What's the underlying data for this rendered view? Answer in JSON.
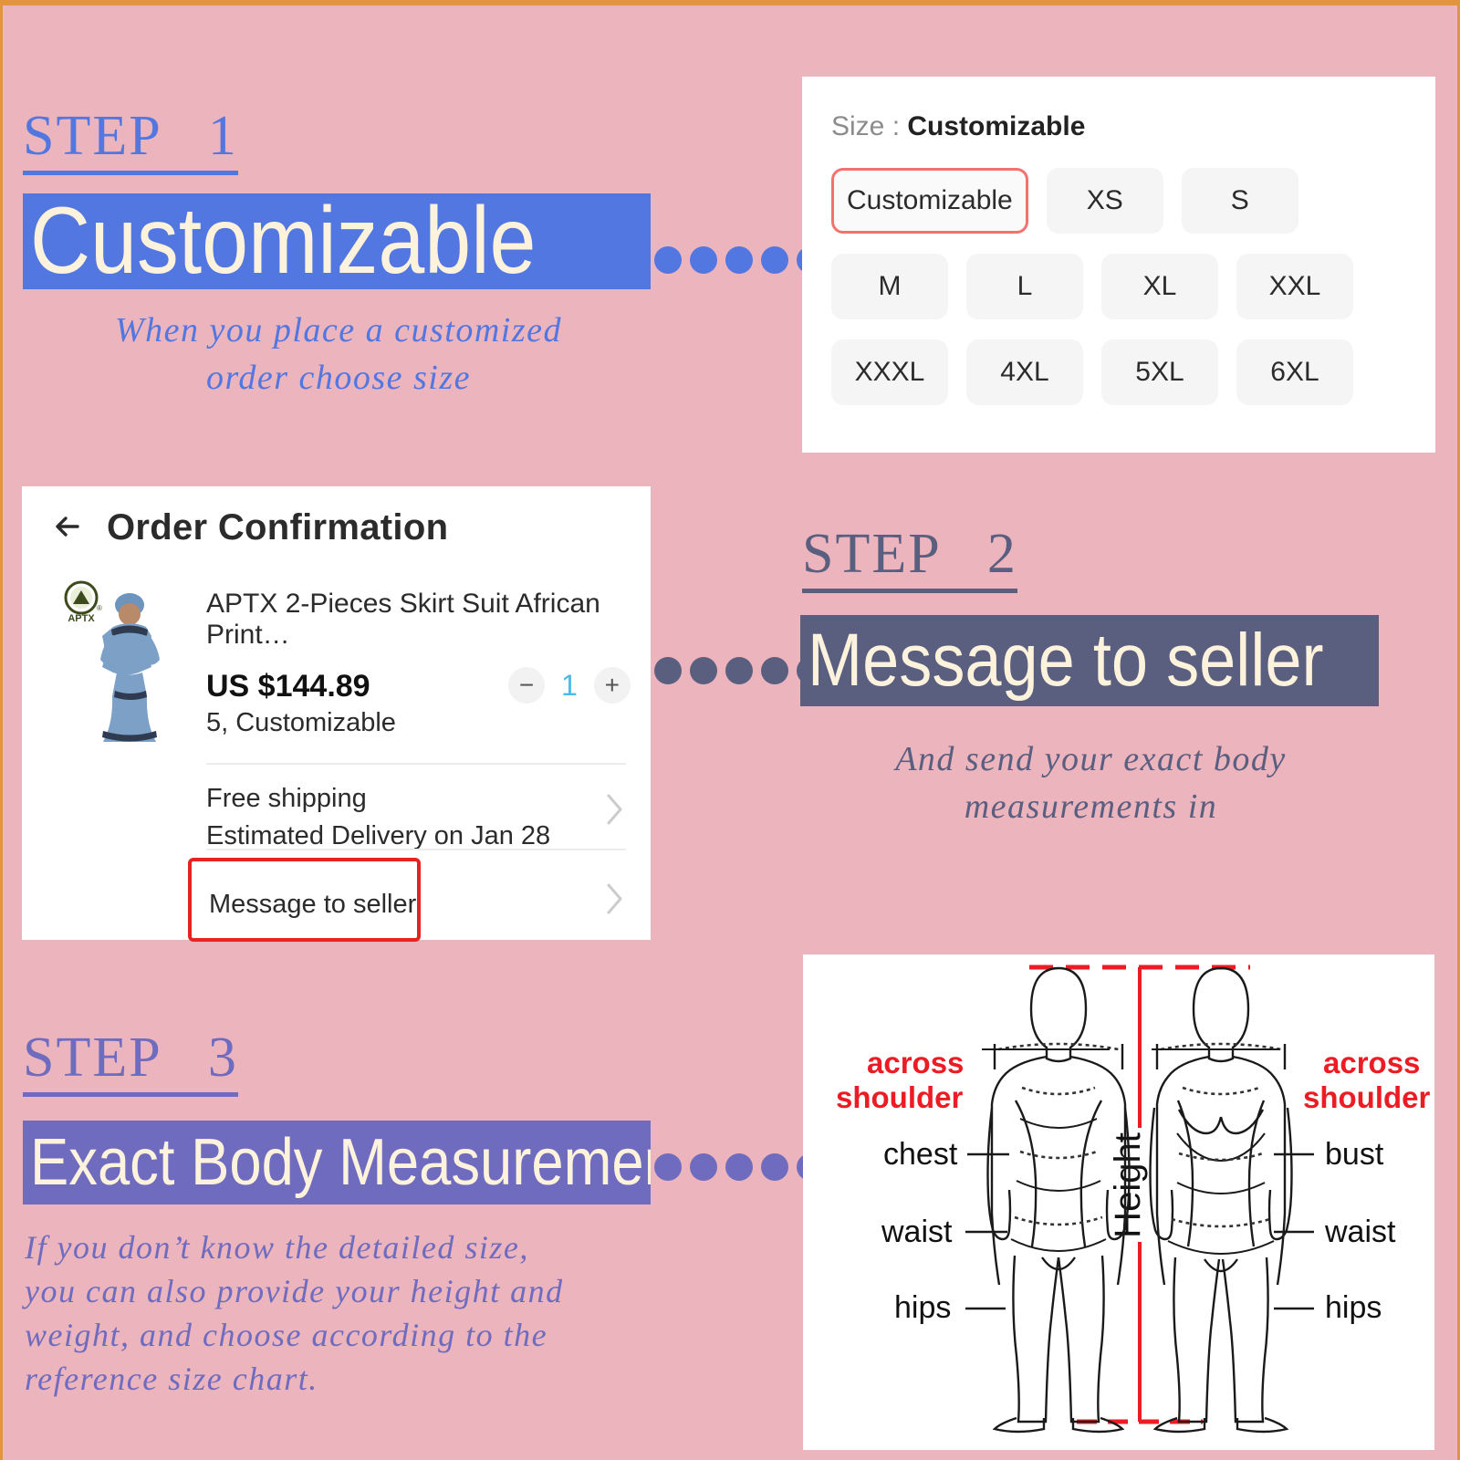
{
  "page": {
    "background_color": "#ecb4bc",
    "border_color": "#e39440"
  },
  "steps": [
    {
      "label": "STEP   1",
      "headline": "Customizable",
      "caption": "When you place a customized\norder choose size",
      "accent_color": "#5277e0",
      "dot_color": "#5277e0"
    },
    {
      "label": "STEP   2",
      "headline": "Message to seller",
      "caption": "And send your exact body\nmeasurements in",
      "accent_color": "#5a5f80",
      "dot_color": "#5a5f80"
    },
    {
      "label": "STEP   3",
      "headline": "Exact Body Measurements",
      "caption": "If you don’t know the detailed size,\nyou can also provide your height and\nweight, and choose according to the\nreference size chart.",
      "accent_color": "#6f6cc0",
      "dot_color": "#6f6cc0"
    }
  ],
  "size_panel": {
    "title_label": "Size : ",
    "title_value": "Customizable",
    "selected": "Customizable",
    "selected_border_color": "#f2726f",
    "options_row1": [
      "Customizable",
      "XS",
      "S"
    ],
    "options_row2": [
      "M",
      "L",
      "XL",
      "XXL"
    ],
    "options_row3": [
      "XXXL",
      "4XL",
      "5XL",
      "6XL"
    ]
  },
  "order_panel": {
    "back_icon": "back-arrow-icon",
    "title": "Order Confirmation",
    "brand_logo_text": "APTX",
    "product_name": "APTX 2-Pieces Skirt Suit African Print…",
    "price": "US $144.89",
    "variant": "5,  Customizable",
    "qty_minus": "−",
    "qty_value": "1",
    "qty_plus": "+",
    "shipping_line1": "Free shipping",
    "shipping_line2": "Estimated Delivery on Jan 28",
    "message_row": "Message to seller",
    "highlight_color": "#e52421",
    "chevron": "›"
  },
  "measurement_diagram": {
    "labels_left": [
      "across",
      "shoulder",
      "chest",
      "waist",
      "hips"
    ],
    "labels_right": [
      "across",
      "shoulder",
      "bust",
      "waist",
      "hips"
    ],
    "vertical_label": "Height",
    "red_color": "#ed1c24",
    "left_figure": "male-body-outline",
    "right_figure": "female-body-outline"
  }
}
